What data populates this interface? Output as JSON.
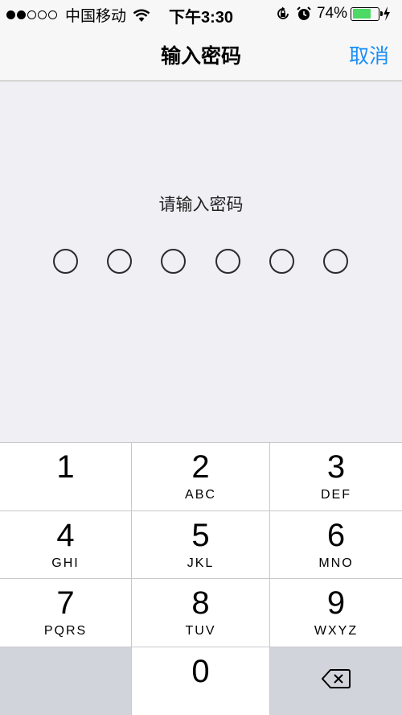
{
  "status_bar": {
    "signal_dots_filled": 2,
    "signal_dots_total": 5,
    "carrier": "中国移动",
    "time": "下午3:30",
    "battery_percent": "74%",
    "battery_level": 0.74,
    "icons": [
      "wifi-icon",
      "orientation-lock-icon",
      "alarm-icon",
      "charging-icon"
    ]
  },
  "nav": {
    "title": "输入密码",
    "cancel": "取消"
  },
  "colors": {
    "accent": "#1a8ef7",
    "battery": "#4cd964",
    "background": "#efeff4",
    "key_dark": "#d1d5db"
  },
  "passcode": {
    "prompt": "请输入密码",
    "length": 6,
    "entered": 0
  },
  "keypad": {
    "k1": {
      "num": "1",
      "letters": ""
    },
    "k2": {
      "num": "2",
      "letters": "ABC"
    },
    "k3": {
      "num": "3",
      "letters": "DEF"
    },
    "k4": {
      "num": "4",
      "letters": "GHI"
    },
    "k5": {
      "num": "5",
      "letters": "JKL"
    },
    "k6": {
      "num": "6",
      "letters": "MNO"
    },
    "k7": {
      "num": "7",
      "letters": "PQRS"
    },
    "k8": {
      "num": "8",
      "letters": "TUV"
    },
    "k9": {
      "num": "9",
      "letters": "WXYZ"
    },
    "k0": {
      "num": "0",
      "letters": ""
    }
  }
}
